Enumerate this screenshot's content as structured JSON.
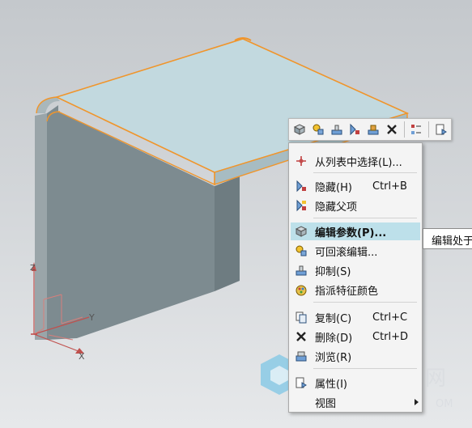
{
  "mini_toolbar": {
    "buttons": [
      {
        "icon": "edit-parameters-icon"
      },
      {
        "icon": "rollback-edit-icon"
      },
      {
        "icon": "suppress-icon"
      },
      {
        "icon": "hide-icon"
      },
      {
        "icon": "specify-color-icon"
      },
      {
        "icon": "delete-icon"
      },
      {
        "icon": "list-icon"
      },
      {
        "icon": "properties-icon"
      }
    ]
  },
  "context_menu": {
    "items": [
      {
        "label": "从列表中选择(L)...",
        "shortcut": "",
        "icon": "select-from-list-icon"
      },
      {
        "label": "隐藏(H)",
        "shortcut": "Ctrl+B",
        "icon": "hide-icon"
      },
      {
        "label": "隐藏父项",
        "shortcut": "",
        "icon": "hide-parents-icon"
      },
      {
        "label": "编辑参数(P)...",
        "shortcut": "",
        "icon": "edit-parameters-icon",
        "highlighted": true
      },
      {
        "label": "可回滚编辑...",
        "shortcut": "",
        "icon": "rollback-edit-icon"
      },
      {
        "label": "抑制(S)",
        "shortcut": "",
        "icon": "suppress-icon"
      },
      {
        "label": "指派特征颜色",
        "shortcut": "",
        "icon": "specify-color-icon"
      },
      {
        "label": "复制(C)",
        "shortcut": "Ctrl+C",
        "icon": "copy-icon"
      },
      {
        "label": "删除(D)",
        "shortcut": "Ctrl+D",
        "icon": "delete-icon"
      },
      {
        "label": "浏览(R)",
        "shortcut": "",
        "icon": "browse-icon"
      },
      {
        "label": "属性(I)",
        "shortcut": "",
        "icon": "properties-icon"
      },
      {
        "label": "视图",
        "shortcut": "",
        "icon": "",
        "submenu": true
      }
    ]
  },
  "tooltip": {
    "text": "编辑处于"
  },
  "triad": {
    "x": "X",
    "y": "Y",
    "z": "Z"
  },
  "watermark": {
    "text": "网",
    "sub": "OM"
  },
  "colors": {
    "top_face": "#c2d9df",
    "side_face": "#7d8b90",
    "highlight_edge": "#f0952b",
    "menu_highlight": "#bde0ea"
  }
}
